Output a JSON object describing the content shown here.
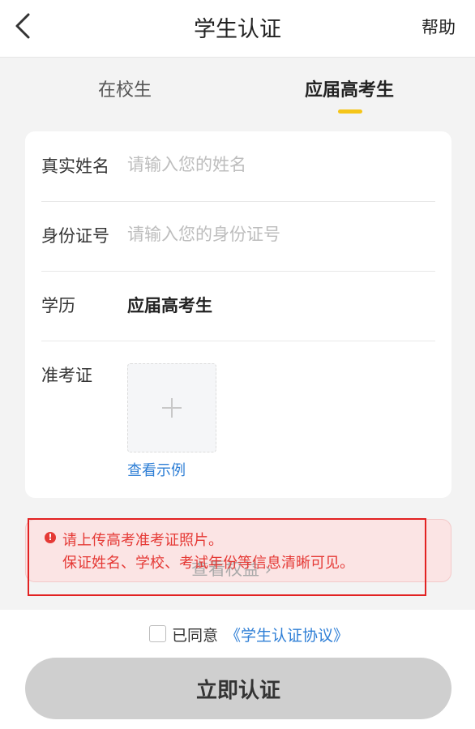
{
  "header": {
    "title": "学生认证",
    "help_label": "帮助",
    "back_icon": "chevron-left-icon"
  },
  "tabs": {
    "in_school": "在校生",
    "graduating": "应届高考生",
    "active": "graduating",
    "underline_color": "#f5c518"
  },
  "form": {
    "name": {
      "label": "真实姓名",
      "placeholder": "请输入您的姓名",
      "value": ""
    },
    "id_number": {
      "label": "身份证号",
      "placeholder": "请输入您的身份证号",
      "value": ""
    },
    "education": {
      "label": "学历",
      "value": "应届高考生"
    },
    "exam_ticket": {
      "label": "准考证",
      "upload_icon": "plus-icon",
      "example_link": "查看示例"
    }
  },
  "notice": {
    "background_text": "查看权益 ›",
    "error_line1": "请上传高考准考证照片。",
    "error_line2": "保证姓名、学校、考试年份等信息清晰可见。",
    "error_color": "#e53935"
  },
  "agreement": {
    "prefix": "已同意",
    "link": "《学生认证协议》",
    "checked": false
  },
  "submit": {
    "label": "立即认证"
  }
}
